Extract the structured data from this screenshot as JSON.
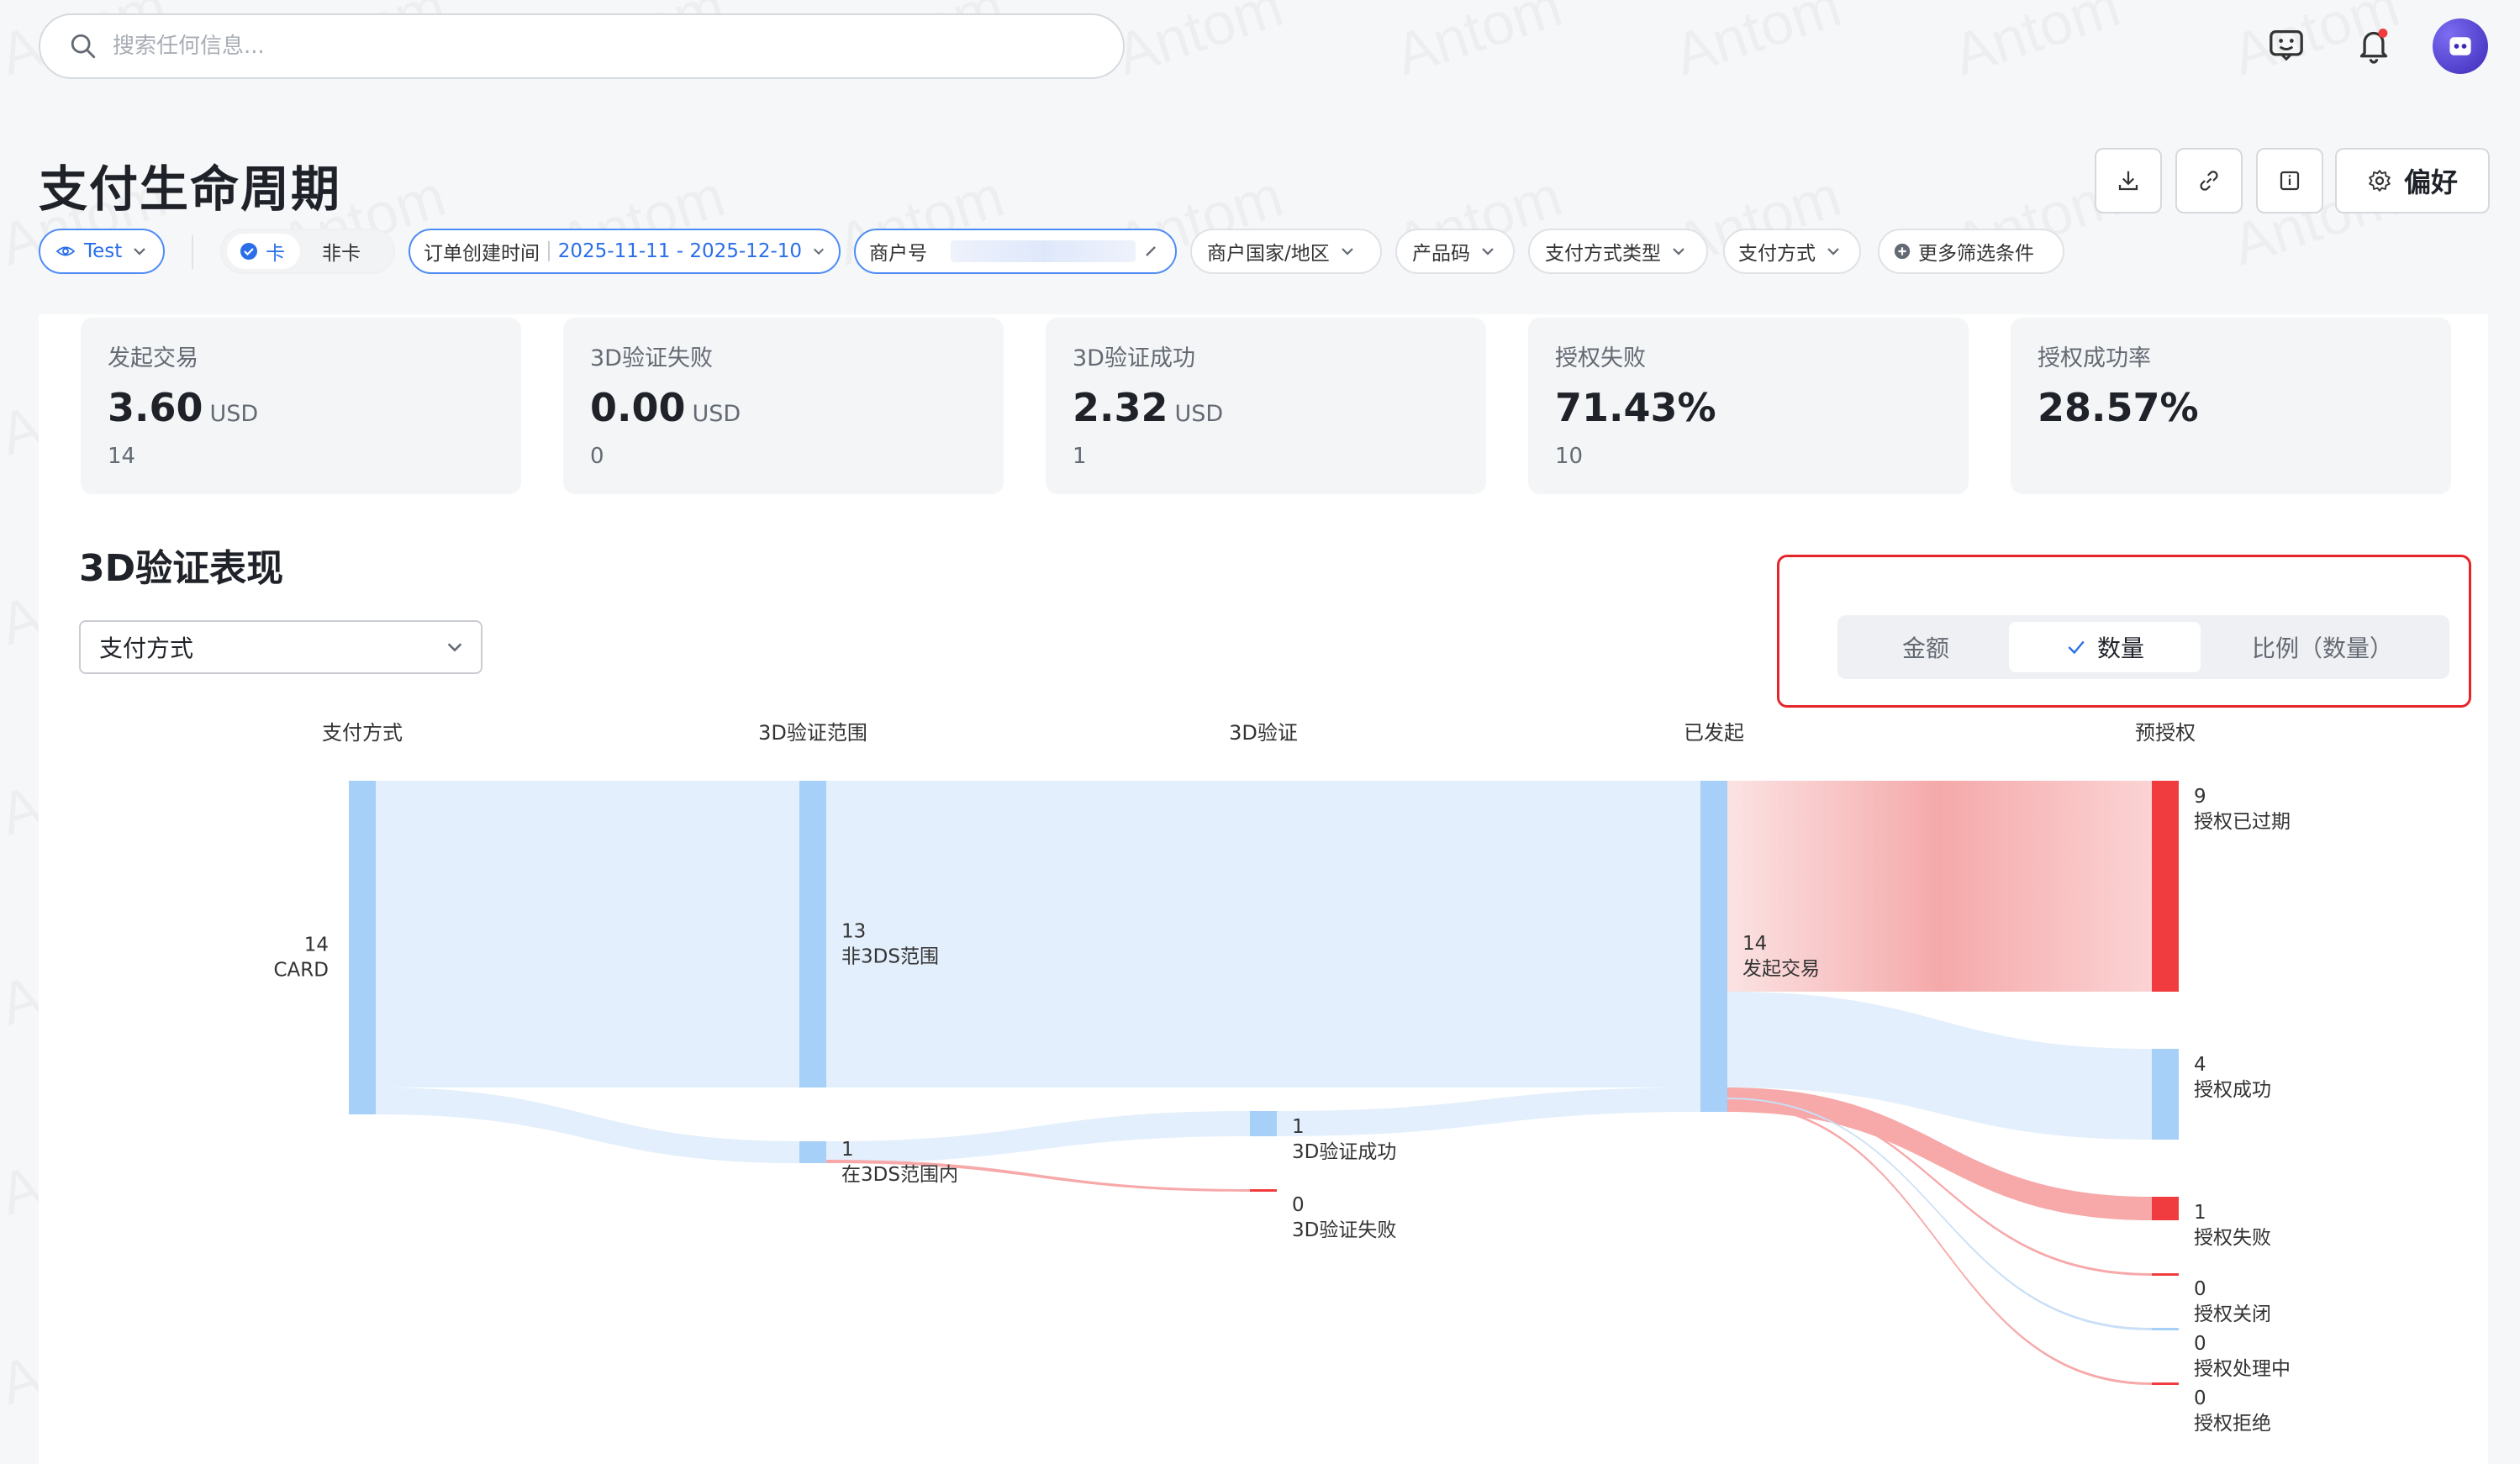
{
  "search": {
    "placeholder": "搜索任何信息..."
  },
  "page": {
    "title": "支付生命周期",
    "preferences_label": "偏好"
  },
  "filters": {
    "env": "Test",
    "card_on": "卡",
    "card_off": "非卡",
    "order_time_label": "订单创建时间",
    "order_time_value": "2025-11-11 - 2025-12-10",
    "merchant_label": "商户号",
    "country": "商户国家/地区",
    "product_code": "产品码",
    "payment_method_type": "支付方式类型",
    "payment_method": "支付方式",
    "more_filters": "更多筛选条件"
  },
  "kpis": [
    {
      "label": "发起交易",
      "value": "3.60",
      "unit": "USD",
      "count": "14"
    },
    {
      "label": "3D验证失败",
      "value": "0.00",
      "unit": "USD",
      "count": "0"
    },
    {
      "label": "3D验证成功",
      "value": "2.32",
      "unit": "USD",
      "count": "1"
    },
    {
      "label": "授权失败",
      "value": "71.43%",
      "unit": "",
      "count": "10"
    },
    {
      "label": "授权成功率",
      "value": "28.57%",
      "unit": "",
      "count": ""
    }
  ],
  "section": {
    "title": "3D验证表现",
    "dimension_select": "支付方式",
    "tabs": [
      "金额",
      "数量",
      "比例（数量）"
    ],
    "active_tab": 1
  },
  "sankey": {
    "columns": [
      "支付方式",
      "3D验证范围",
      "3D验证",
      "已发起",
      "预授权"
    ],
    "nodes": [
      {
        "id": "card",
        "col": 0,
        "value": "14",
        "label": "CARD"
      },
      {
        "id": "non3ds",
        "col": 1,
        "value": "13",
        "label": "非3DS范围"
      },
      {
        "id": "in3ds",
        "col": 1,
        "value": "1",
        "label": "在3DS范围内"
      },
      {
        "id": "ok3d",
        "col": 2,
        "value": "1",
        "label": "3D验证成功"
      },
      {
        "id": "fail3d",
        "col": 2,
        "value": "0",
        "label": "3D验证失败"
      },
      {
        "id": "init",
        "col": 3,
        "value": "14",
        "label": "发起交易"
      },
      {
        "id": "expired",
        "col": 4,
        "value": "9",
        "label": "授权已过期"
      },
      {
        "id": "success",
        "col": 4,
        "value": "4",
        "label": "授权成功"
      },
      {
        "id": "failed",
        "col": 4,
        "value": "1",
        "label": "授权失败"
      },
      {
        "id": "closed",
        "col": 4,
        "value": "0",
        "label": "授权关闭"
      },
      {
        "id": "processing",
        "col": 4,
        "value": "0",
        "label": "授权处理中"
      },
      {
        "id": "rejected",
        "col": 4,
        "value": "0",
        "label": "授权拒绝"
      }
    ],
    "colors": {
      "node": "#a6d0f7",
      "link": "#e3effc",
      "fail": "#f03c3f",
      "fail_link": "#f7a8a9"
    }
  },
  "watermark": "Antom"
}
